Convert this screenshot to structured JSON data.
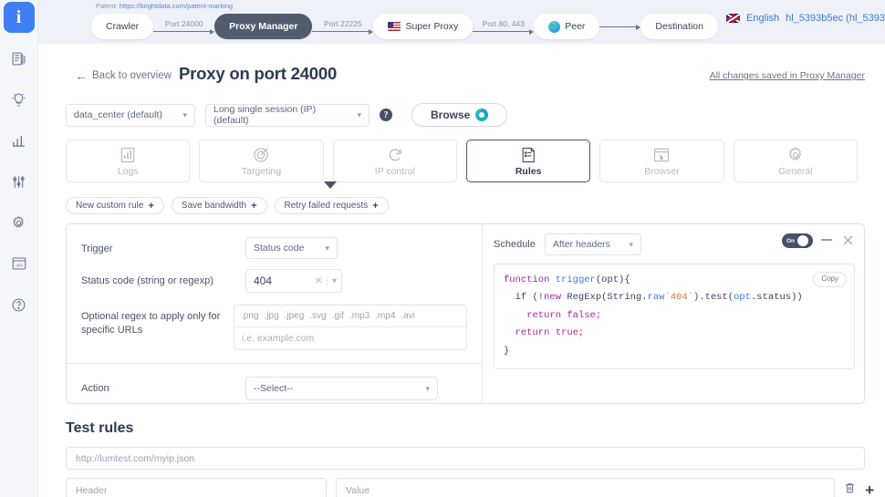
{
  "rail": {
    "logo": "i",
    "items": [
      {
        "name": "logs-icon",
        "label": "Logs"
      },
      {
        "name": "lightbulb-icon",
        "label": "Tips"
      },
      {
        "name": "stats-icon",
        "label": "Statistics"
      },
      {
        "name": "sliders-icon",
        "label": "Settings"
      },
      {
        "name": "gear-icon",
        "label": "Preferences"
      },
      {
        "name": "api-icon",
        "label": "API"
      },
      {
        "name": "help-icon",
        "label": "Help"
      }
    ]
  },
  "flow": {
    "patent_prefix": "Patent: ",
    "patent_url": "https://brightdata.com/patent-marking",
    "nodes": [
      {
        "label": "Crawler",
        "active": false,
        "icon": null
      },
      {
        "label": "Proxy Manager",
        "active": true,
        "icon": null
      },
      {
        "label": "Super Proxy",
        "active": false,
        "icon": "us-flag-icon"
      },
      {
        "label": "Peer",
        "active": false,
        "icon": "globe-icon"
      },
      {
        "label": "Destination",
        "active": false,
        "icon": null
      }
    ],
    "edges": [
      "Port 24000",
      "Port 22225",
      "Port 80, 443",
      ""
    ],
    "language": "English",
    "account": "hl_5393b5ec (hl_5393"
  },
  "header": {
    "back_label": "Back to overview",
    "title": "Proxy on port 24000",
    "saved_text": "All changes saved in Proxy Manager"
  },
  "controls": {
    "zone": "data_center (default)",
    "session": "Long single session (IP) (default)",
    "browse_label": "Browse"
  },
  "tabs": [
    {
      "label": "Logs",
      "icon": "logs-chart-icon",
      "selected": false
    },
    {
      "label": "Targeting",
      "icon": "target-icon",
      "selected": false
    },
    {
      "label": "IP control",
      "icon": "refresh-icon",
      "selected": false
    },
    {
      "label": "Rules",
      "icon": "rules-list-icon",
      "selected": true
    },
    {
      "label": "Browser",
      "icon": "browser-cursor-icon",
      "selected": false
    },
    {
      "label": "General",
      "icon": "gear-icon",
      "selected": false
    }
  ],
  "rule_buttons": [
    {
      "label": "New custom rule",
      "glyph": "+"
    },
    {
      "label": "Save bandwidth",
      "glyph": "+"
    },
    {
      "label": "Retry failed requests",
      "glyph": "+"
    }
  ],
  "rule": {
    "trigger_label": "Trigger",
    "trigger_value": "Status code",
    "status_label": "Status code (string or regexp)",
    "status_value": "404",
    "regex_label": "Optional regex to apply only for specific URLs",
    "extensions": [
      ".png",
      ".jpg",
      ".jpeg",
      ".svg",
      ".gif",
      ".mp3",
      ".mp4",
      ".avi"
    ],
    "regex_placeholder": "i.e. example.com",
    "action_label": "Action",
    "action_value": "--Select--",
    "schedule_label": "Schedule",
    "schedule_value": "After headers",
    "toggle_state": "On",
    "copy_label": "Copy",
    "code": {
      "line1_kw": "function",
      "line1_fn": "trigger",
      "line1_rest": "(opt){",
      "line2_a": "  if (!",
      "line2_new": "new",
      "line2_b": " RegExp(String.",
      "line2_raw": "raw",
      "line2_tick1": "`",
      "line2_str": "404",
      "line2_tick2": "`",
      "line2_c": ").test(",
      "line2_opt": "opt",
      "line2_d": ".status))",
      "line3_kw": "    return",
      "line3_val": " false;",
      "line4_kw": "  return",
      "line4_val": " true;",
      "line5": "}"
    }
  },
  "test": {
    "title": "Test rules",
    "url_placeholder": "http://lumtest.com/myip.json",
    "header_placeholder": "Header",
    "value_placeholder": "Value",
    "trash_icon": "trash-icon",
    "add_icon": "plus-icon"
  },
  "colors": {
    "accent": "#3f7ff5",
    "active_node": "#505c6e",
    "toggle_on": "#44506a",
    "link": "#3c7be0"
  }
}
